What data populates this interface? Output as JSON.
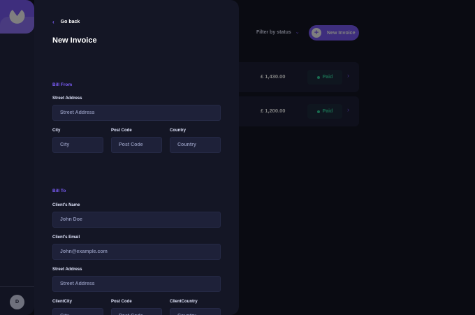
{
  "sidebar": {
    "avatar_initial": "D"
  },
  "main": {
    "filter_label": "Filter by status",
    "new_invoice_label": "New Invoice",
    "invoices": [
      {
        "amount": "£ 1,430.00",
        "status": "Paid"
      },
      {
        "amount": "£ 1,200.00",
        "status": "Paid"
      }
    ]
  },
  "form": {
    "go_back": "Go back",
    "title": "New Invoice",
    "bill_from": {
      "heading": "Bill From",
      "street_label": "Street Address",
      "street_placeholder": "Street Address",
      "city_label": "City",
      "city_placeholder": "City",
      "postcode_label": "Post Code",
      "postcode_placeholder": "Post Code",
      "country_label": "Country",
      "country_placeholder": "Country"
    },
    "bill_to": {
      "heading": "Bill To",
      "client_name_label": "Client's Name",
      "client_name_placeholder": "John Doe",
      "client_email_label": "Client's Email",
      "client_email_placeholder": "John@example.com",
      "street_label": "Street Address",
      "street_placeholder": "Street Address",
      "city_label": "ClientCity",
      "city_placeholder": "City",
      "postcode_label": "Post Code",
      "postcode_placeholder": "Post Code",
      "country_label": "ClientCountry",
      "country_placeholder": "Country"
    }
  },
  "colors": {
    "accent": "#7c5dfa",
    "paid": "#33d69f",
    "background": "#141625",
    "panel": "#1e2139"
  }
}
